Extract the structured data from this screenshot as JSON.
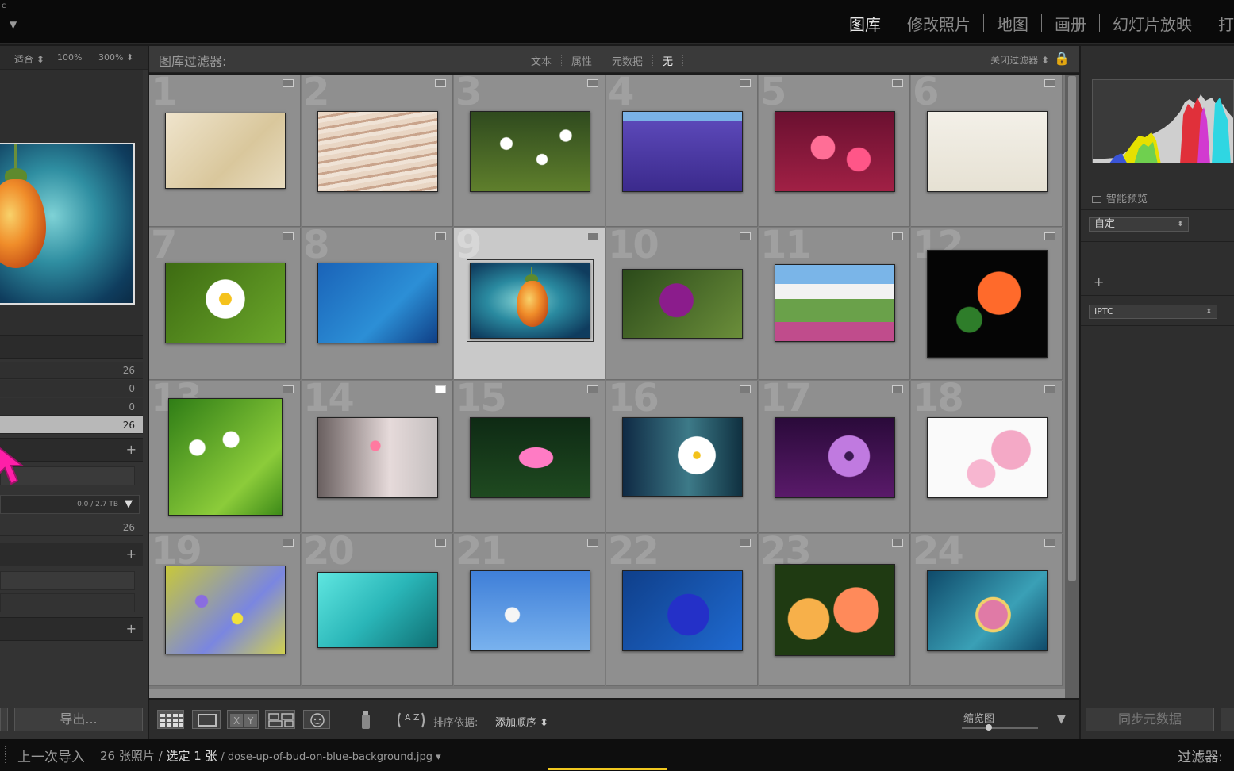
{
  "topbar": {
    "logo_mark": "c",
    "logo_arrow": "▼",
    "modules": [
      {
        "label": "图库",
        "active": true
      },
      {
        "label": "修改照片",
        "active": false
      },
      {
        "label": "地图",
        "active": false
      },
      {
        "label": "画册",
        "active": false
      },
      {
        "label": "幻灯片放映",
        "active": false
      },
      {
        "label": "打",
        "active": false
      }
    ]
  },
  "navigator": {
    "zoom_fit": "适合 ⬍",
    "zoom_100": "100%",
    "zoom_300": "300% ⬍"
  },
  "catalog": {
    "counts": [
      "26",
      "0",
      "0",
      "26"
    ],
    "selected_index": 3
  },
  "folders": {
    "disk_usage": "0.0 / 2.7 TB",
    "count": "26"
  },
  "filter": {
    "title": "图库过滤器:",
    "options": [
      "文本",
      "属性",
      "元数据",
      "无"
    ],
    "active_option": "无",
    "close_label": "关闭过滤器 ⬍",
    "lock_icon": "🔒"
  },
  "grid": {
    "cells": [
      {
        "n": "1"
      },
      {
        "n": "2"
      },
      {
        "n": "3"
      },
      {
        "n": "4"
      },
      {
        "n": "5"
      },
      {
        "n": "6"
      },
      {
        "n": "7"
      },
      {
        "n": "8"
      },
      {
        "n": "9"
      },
      {
        "n": "10"
      },
      {
        "n": "11"
      },
      {
        "n": "12"
      },
      {
        "n": "13"
      },
      {
        "n": "14"
      },
      {
        "n": "15"
      },
      {
        "n": "16"
      },
      {
        "n": "17"
      },
      {
        "n": "18"
      },
      {
        "n": "19"
      },
      {
        "n": "20"
      },
      {
        "n": "21"
      },
      {
        "n": "22"
      },
      {
        "n": "23"
      },
      {
        "n": "24"
      }
    ],
    "selected_number": "9"
  },
  "right_panel": {
    "smart_preview": "智能预览",
    "preset_select": "自定",
    "metadata_select": "IPTC",
    "sync_button": "同步元数据"
  },
  "toolbar": {
    "sort_label": "排序依据:",
    "sort_value": "添加顺序 ⬍",
    "thumb_size_label": "缩览图",
    "menu_arrow": "▼",
    "az_label": "A Z"
  },
  "left_buttons": {
    "export": "导出..."
  },
  "status": {
    "source": "上一次导入",
    "photos": "26 张照片 /",
    "selected": "选定 1 张",
    "filename": "/ dose-up-of-bud-on-blue-background.jpg ▾",
    "filter_label": "过滤器:"
  },
  "colors": {
    "selected_cell": "#c9c9c9",
    "grid_cell": "#8f8f8f",
    "cursor_magenta": "#ff1fa8",
    "caption_yellow": "#f1c81f"
  }
}
